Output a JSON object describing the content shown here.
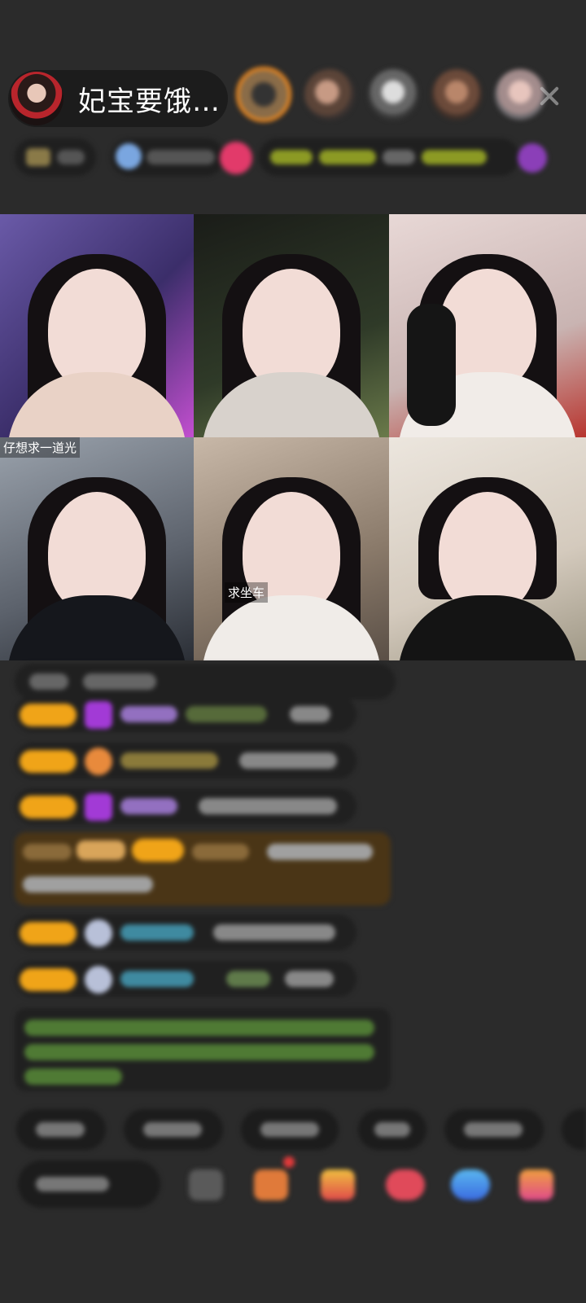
{
  "header": {
    "host_name": "妃宝要饿…",
    "viewers": [
      "viewer-1",
      "viewer-2",
      "viewer-3",
      "viewer-4",
      "viewer-5"
    ],
    "close_icon": "close-icon"
  },
  "video_grid": {
    "tiles": [
      {
        "label": ""
      },
      {
        "label": ""
      },
      {
        "label": ""
      },
      {
        "label": "仔想求一道光"
      },
      {
        "label": "求坐车"
      },
      {
        "label": ""
      }
    ]
  },
  "colors": {
    "background": "#2b2b2b",
    "badge_gold": "#f0a418",
    "gem_purple": "#a23ad6",
    "highlight_banner": "#4a3516",
    "green_text": "#7fbf5a"
  }
}
